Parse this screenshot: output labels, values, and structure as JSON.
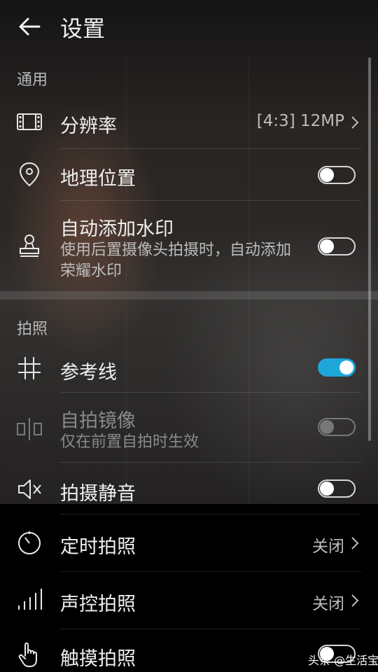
{
  "header": {
    "title": "设置",
    "back_icon": "back-arrow-icon"
  },
  "sections": {
    "general": "通用",
    "photo": "拍照"
  },
  "rows": {
    "resolution": {
      "label": "分辨率",
      "value": "[4:3] 12MP",
      "icon": "film-icon"
    },
    "location": {
      "label": "地理位置",
      "icon": "location-pin-icon",
      "enabled": false
    },
    "watermark": {
      "label": "自动添加水印",
      "sub": "使用后置摄像头拍摄时，自动添加荣耀水印",
      "icon": "stamp-icon",
      "enabled": false
    },
    "grid": {
      "label": "参考线",
      "icon": "grid-icon",
      "enabled": true
    },
    "mirror": {
      "label": "自拍镜像",
      "sub": "仅在前置自拍时生效",
      "icon": "mirror-icon",
      "enabled": false,
      "disabled": true
    },
    "mute": {
      "label": "拍摄静音",
      "icon": "mute-speaker-icon",
      "enabled": false
    },
    "timer": {
      "label": "定时拍照",
      "value": "关闭",
      "icon": "timer-icon"
    },
    "voice": {
      "label": "声控拍照",
      "value": "关闭",
      "icon": "sound-bars-icon"
    },
    "touch": {
      "label": "触摸拍照",
      "icon": "touch-hand-icon",
      "enabled": false
    }
  },
  "colors": {
    "accent": "#1fa6d8",
    "background": "#000000"
  },
  "watermark_text": "头条 @生活宝"
}
